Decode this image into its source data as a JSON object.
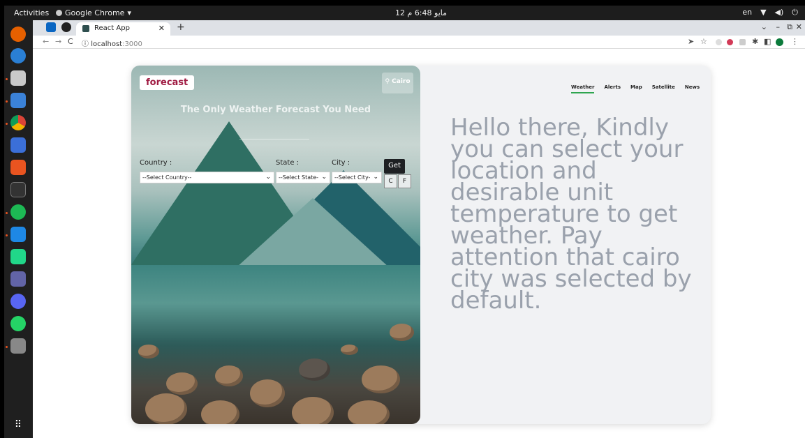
{
  "system": {
    "activities": "Activities",
    "app": "Google Chrome",
    "clock": "12 مايو  6:48 م",
    "lang": "en"
  },
  "browser": {
    "tab_title": "React App",
    "url_host": "localhost",
    "url_port": ":3000"
  },
  "app": {
    "logo": "forecast",
    "location": "Cairo",
    "tagline": "The Only Weather Forecast You Need",
    "labels": {
      "country": "Country :",
      "state": "State :",
      "city": "City :"
    },
    "selects": {
      "country": "--Select Country--",
      "state": "--Select State-",
      "city": "--Select City-"
    },
    "get": "Get",
    "unit_c": "C",
    "unit_f": "F",
    "nav": [
      "Weather",
      "Alerts",
      "Map",
      "Satellite",
      "News"
    ],
    "message": "Hello there, Kindly you can select your location and desirable unit temperature to get weather. Pay attention that cairo city was selected by default."
  },
  "colors": {
    "brand": "#a01c43",
    "active": "#2ea54f",
    "message": "#9aa1ac"
  }
}
